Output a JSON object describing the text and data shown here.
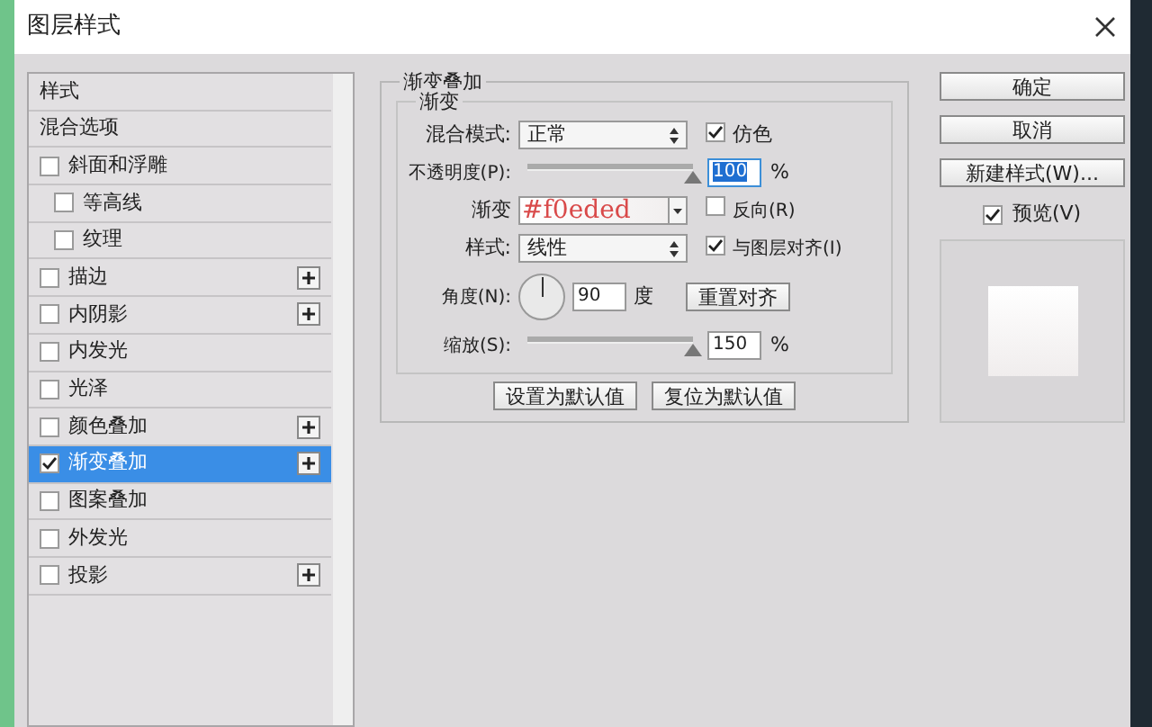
{
  "window": {
    "title": "图层样式"
  },
  "sidebar": {
    "items": [
      {
        "kind": "heading",
        "label": "样式",
        "selected": false
      },
      {
        "kind": "heading",
        "label": "混合选项",
        "selected": false
      },
      {
        "kind": "effect",
        "label": "斜面和浮雕",
        "checked": false,
        "plus": false,
        "selected": false,
        "children": [
          {
            "kind": "effect",
            "label": "等高线",
            "checked": false,
            "plus": false,
            "selected": false
          },
          {
            "kind": "effect",
            "label": "纹理",
            "checked": false,
            "plus": false,
            "selected": false
          }
        ]
      },
      {
        "kind": "effect",
        "label": "描边",
        "checked": false,
        "plus": true,
        "selected": false
      },
      {
        "kind": "effect",
        "label": "内阴影",
        "checked": false,
        "plus": true,
        "selected": false
      },
      {
        "kind": "effect",
        "label": "内发光",
        "checked": false,
        "plus": false,
        "selected": false
      },
      {
        "kind": "effect",
        "label": "光泽",
        "checked": false,
        "plus": false,
        "selected": false
      },
      {
        "kind": "effect",
        "label": "颜色叠加",
        "checked": false,
        "plus": true,
        "selected": false
      },
      {
        "kind": "effect",
        "label": "渐变叠加",
        "checked": true,
        "plus": true,
        "selected": true
      },
      {
        "kind": "effect",
        "label": "图案叠加",
        "checked": false,
        "plus": false,
        "selected": false
      },
      {
        "kind": "effect",
        "label": "外发光",
        "checked": false,
        "plus": false,
        "selected": false
      },
      {
        "kind": "effect",
        "label": "投影",
        "checked": false,
        "plus": true,
        "selected": false
      }
    ]
  },
  "panel": {
    "title": "渐变叠加",
    "group_title": "渐变",
    "blend_mode": {
      "label": "混合模式:",
      "value": "正常"
    },
    "dither": {
      "label": "仿色",
      "checked": true
    },
    "opacity": {
      "label": "不透明度(P):",
      "level": 1,
      "value": "100",
      "unit": "%"
    },
    "gradient": {
      "label": "渐变",
      "annotation": "#f0eded"
    },
    "reverse": {
      "label": "反向(R)",
      "checked": false
    },
    "style": {
      "label": "样式:",
      "value": "线性"
    },
    "align": {
      "label": "与图层对齐(I)",
      "checked": true
    },
    "angle": {
      "label": "角度(N):",
      "value": "90",
      "unit": "度"
    },
    "reset_align": "重置对齐",
    "scale": {
      "label": "缩放(S):",
      "level": 1,
      "value": "150",
      "unit": "%"
    },
    "buttons": [
      "设置为默认值",
      "复位为默认值"
    ]
  },
  "actions": {
    "buttons": [
      "确定",
      "取消",
      "新建样式(W)..."
    ],
    "preview": {
      "label": "预览(V)",
      "checked": true
    }
  }
}
